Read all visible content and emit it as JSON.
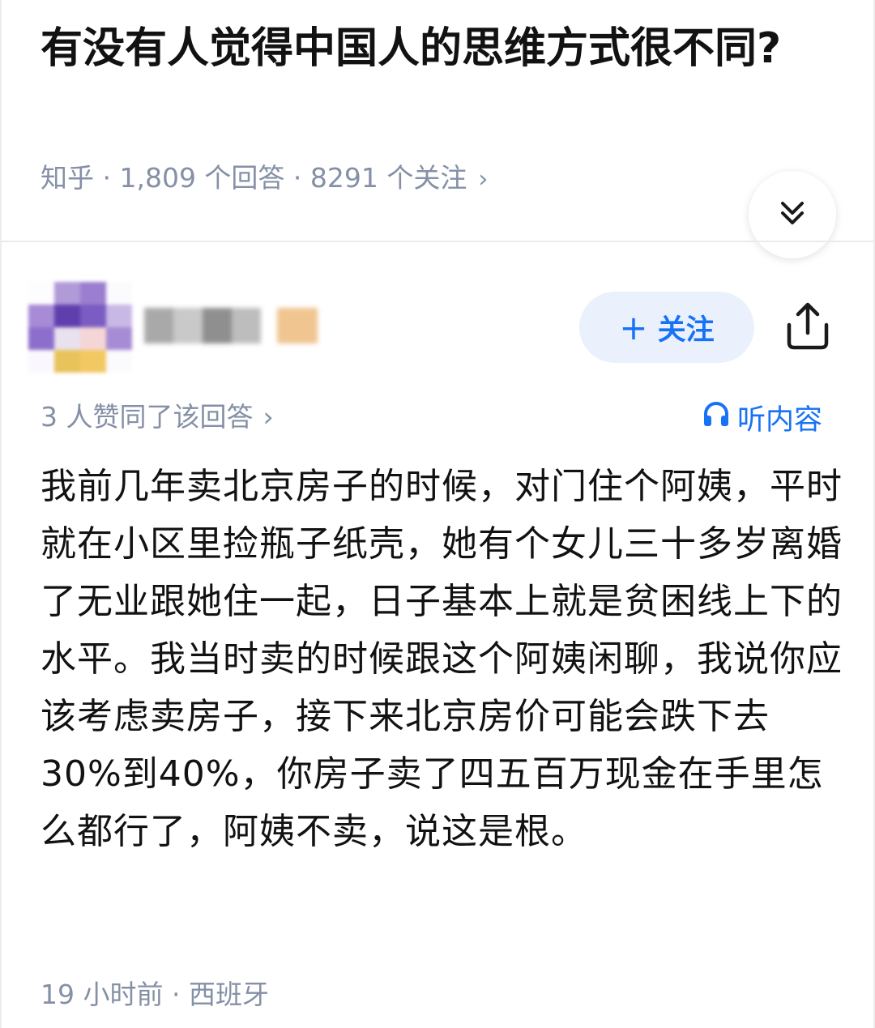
{
  "question": {
    "title": "有没有人觉得中国人的思维方式很不同?",
    "meta": "知乎 · 1,809 个回答 · 8291 个关注",
    "meta_chevron": "›"
  },
  "author": {
    "follow_plus": "+",
    "follow_label": "关注"
  },
  "answer": {
    "likes_text": "3 人赞同了该回答",
    "likes_chevron": "›",
    "listen_label": "听内容",
    "body": "我前几年卖北京房子的时候，对门住个阿姨，平时就在小区里捡瓶子纸壳，她有个女儿三十多岁离婚了无业跟她住一起，日子基本上就是贫困线上下的水平。我当时卖的时候跟这个阿姨闲聊，我说你应该考虑卖房子，接下来北京房价可能会跌下去30%到40%，你房子卖了四五百万现金在手里怎么都行了，阿姨不卖，说这是根。",
    "footer": "19 小时前 · 西班牙"
  },
  "colors": {
    "accent": "#1772f6",
    "follow_bg": "#eaf1fd",
    "meta_gray": "#8590a6"
  },
  "icons": {
    "collapse": "double-chevron-down-icon",
    "share": "share-icon",
    "listen": "headphones-icon"
  }
}
